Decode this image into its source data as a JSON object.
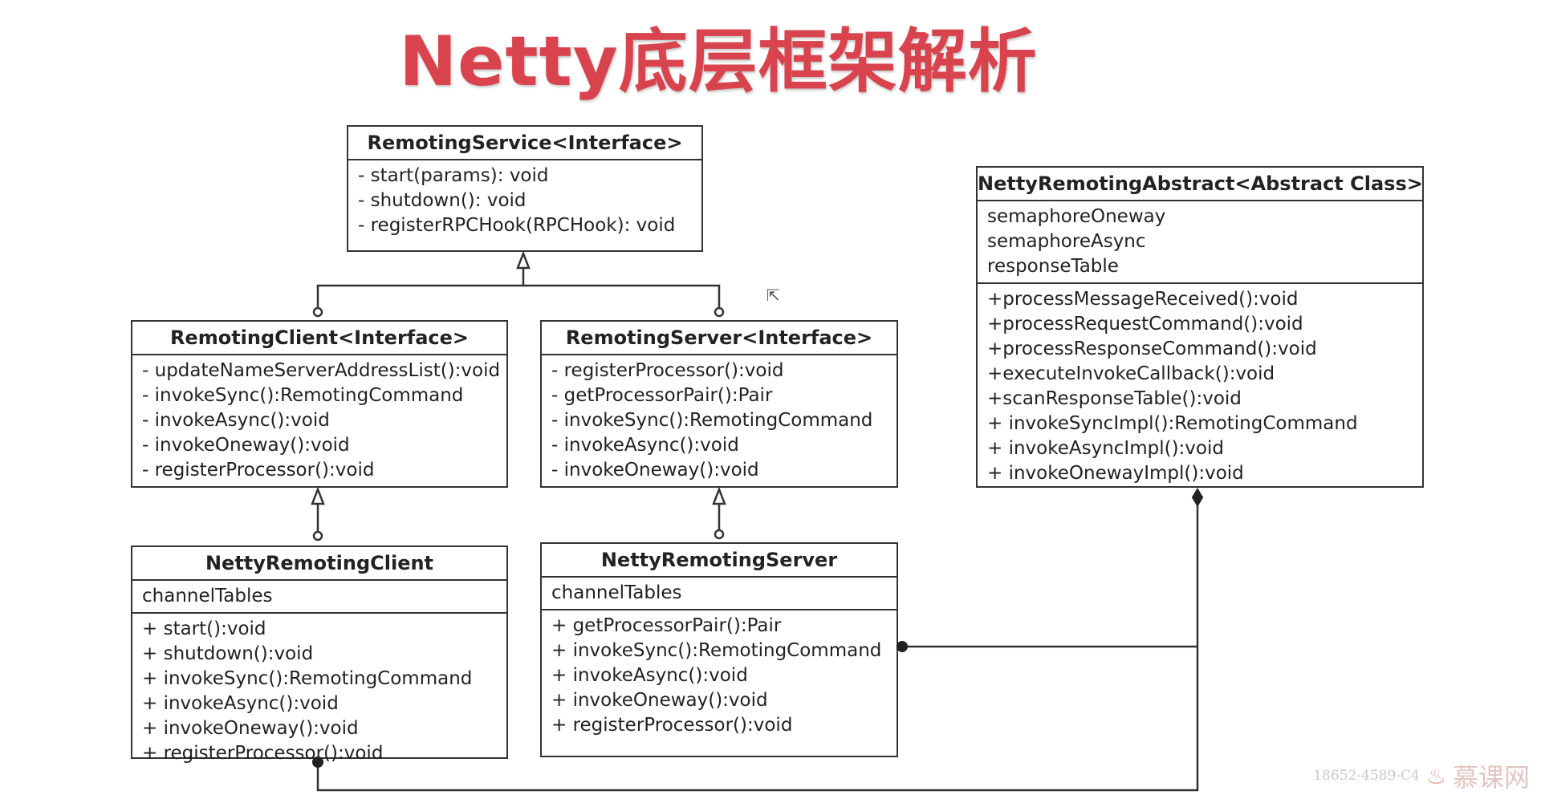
{
  "title": "Netty底层框架解析",
  "classes": {
    "remoting_service": {
      "header": "RemotingService<Interface>",
      "methods": [
        "- start(params): void",
        "- shutdown(): void",
        "- registerRPCHook(RPCHook): void"
      ]
    },
    "remoting_client": {
      "header": "RemotingClient<Interface>",
      "methods": [
        "- updateNameServerAddressList():void",
        "- invokeSync():RemotingCommand",
        "- invokeAsync():void",
        "- invokeOneway():void",
        "- registerProcessor():void"
      ]
    },
    "remoting_server": {
      "header": "RemotingServer<Interface>",
      "methods": [
        "- registerProcessor():void",
        "- getProcessorPair():Pair",
        "- invokeSync():RemotingCommand",
        "- invokeAsync():void",
        "- invokeOneway():void"
      ]
    },
    "netty_remoting_abstract": {
      "header": "NettyRemotingAbstract<Abstract Class>",
      "fields": [
        "semaphoreOneway",
        "semaphoreAsync",
        "responseTable"
      ],
      "methods": [
        "+processMessageReceived():void",
        "+processRequestCommand():void",
        "+processResponseCommand():void",
        "+executeInvokeCallback():void",
        "+scanResponseTable():void",
        "+ invokeSyncImpl():RemotingCommand",
        "+ invokeAsyncImpl():void",
        "+ invokeOnewayImpl():void"
      ]
    },
    "netty_remoting_client": {
      "header": "NettyRemotingClient",
      "fields": [
        "channelTables"
      ],
      "methods": [
        "+ start():void",
        "+ shutdown():void",
        "+ invokeSync():RemotingCommand",
        "+ invokeAsync():void",
        "+ invokeOneway():void",
        "+ registerProcessor():void"
      ]
    },
    "netty_remoting_server": {
      "header": "NettyRemotingServer",
      "fields": [
        "channelTables"
      ],
      "methods": [
        "+ getProcessorPair():Pair",
        "+ invokeSync():RemotingCommand",
        "+ invokeAsync():void",
        "+ invokeOneway():void",
        "+ registerProcessor():void"
      ]
    }
  },
  "watermark": {
    "id": "18652-4589-C4",
    "logo": "慕课网",
    "logo_icon": "flame-icon"
  },
  "colors": {
    "title": "#d9434d",
    "line": "#333333"
  }
}
